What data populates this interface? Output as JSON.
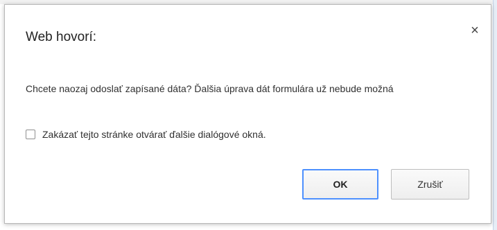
{
  "dialog": {
    "title": "Web hovorí:",
    "close_label": "×",
    "message": "Chcete naozaj odoslať zapísané dáta? Ďalšia úprava dát formulára už nebude možná",
    "checkbox": {
      "label": "Zakázať tejto stránke otvárať ďalšie dialógové okná.",
      "checked": false
    },
    "buttons": {
      "ok_label": "OK",
      "cancel_label": "Zrušiť"
    },
    "colors": {
      "focus_border": "#4d90fe",
      "dialog_border": "#b8b8b8"
    }
  }
}
